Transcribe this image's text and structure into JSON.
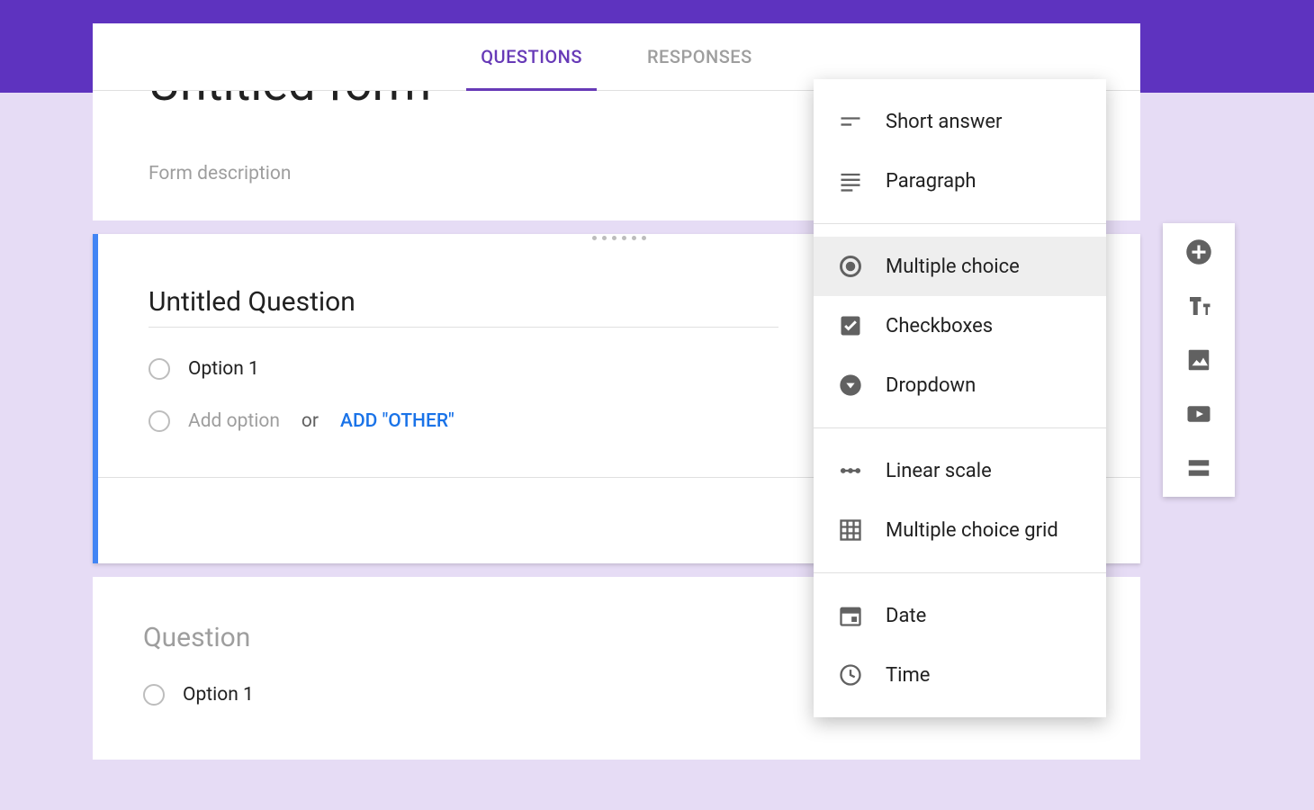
{
  "tabs": {
    "questions": "QUESTIONS",
    "responses": "RESPONSES",
    "active": "questions"
  },
  "header": {
    "title": "Untitled form",
    "description_placeholder": "Form description"
  },
  "active_question": {
    "title": "Untitled Question",
    "option1": "Option 1",
    "add_option_label": "Add option",
    "or_word": "or",
    "add_other_label": "ADD \"OTHER\""
  },
  "inactive_question": {
    "title": "Question",
    "option1": "Option 1"
  },
  "type_menu": {
    "groups": [
      {
        "items": [
          {
            "id": "short-answer",
            "label": "Short answer"
          },
          {
            "id": "paragraph",
            "label": "Paragraph"
          }
        ]
      },
      {
        "items": [
          {
            "id": "multiple-choice",
            "label": "Multiple choice",
            "selected": true
          },
          {
            "id": "checkboxes",
            "label": "Checkboxes"
          },
          {
            "id": "dropdown",
            "label": "Dropdown"
          }
        ]
      },
      {
        "items": [
          {
            "id": "linear-scale",
            "label": "Linear scale"
          },
          {
            "id": "multiple-choice-grid",
            "label": "Multiple choice grid"
          }
        ]
      },
      {
        "items": [
          {
            "id": "date",
            "label": "Date"
          },
          {
            "id": "time",
            "label": "Time"
          }
        ]
      }
    ]
  },
  "side_toolbar": {
    "add_question": "Add question",
    "add_title": "Add title and description",
    "add_image": "Add image",
    "add_video": "Add video",
    "add_section": "Add section"
  }
}
